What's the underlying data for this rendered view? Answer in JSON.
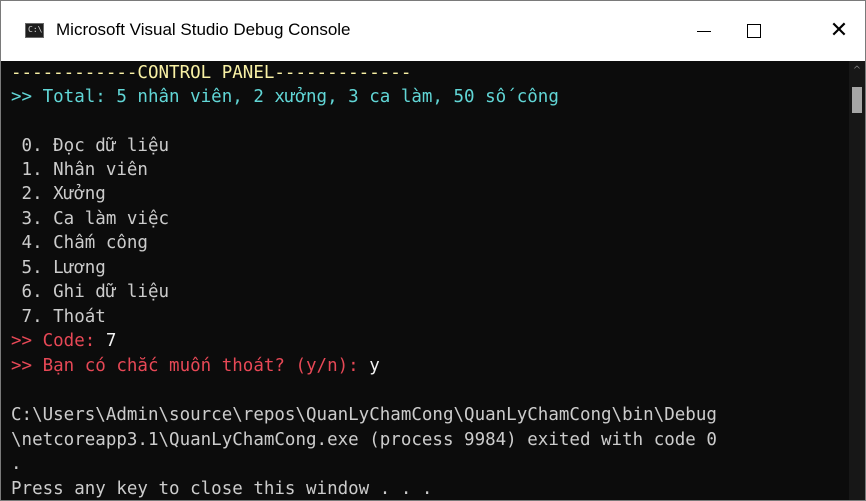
{
  "window": {
    "title": "Microsoft Visual Studio Debug Console",
    "icon_text": "C:\\",
    "controls": {
      "minimize": "minimize-icon",
      "maximize": "maximize-icon",
      "close": "close-icon",
      "close_glyph": "✕"
    }
  },
  "colors": {
    "console_bg": "#0c0c0c",
    "text_default": "#cccccc",
    "header": "#f9f1a5",
    "total": "#61d6d6",
    "prompt": "#e74856",
    "input": "#f2f2f2"
  },
  "console": {
    "header": "------------CONTROL PANEL-------------",
    "total": ">> Total: 5 nhân viên, 2 xưởng, 3 ca làm, 50 số công",
    "menu": [
      " 0. Đọc dữ liệu",
      " 1. Nhân viên",
      " 2. Xưởng",
      " 3. Ca làm việc",
      " 4. Chấm công",
      " 5. Lương",
      " 6. Ghi dữ liệu",
      " 7. Thoát"
    ],
    "code_prompt": ">> Code: ",
    "code_value": "7",
    "confirm_prompt": ">> Bạn có chắc muốn thoát? (y/n): ",
    "confirm_value": "y",
    "exit_line_1": "C:\\Users\\Admin\\source\\repos\\QuanLyChamCong\\QuanLyChamCong\\bin\\Debug",
    "exit_line_2": "\\netcoreapp3.1\\QuanLyChamCong.exe (process 9984) exited with code 0",
    "exit_line_3": ".",
    "press_key": "Press any key to close this window . . ."
  },
  "scrollbar": {
    "up_arrow": "^"
  }
}
